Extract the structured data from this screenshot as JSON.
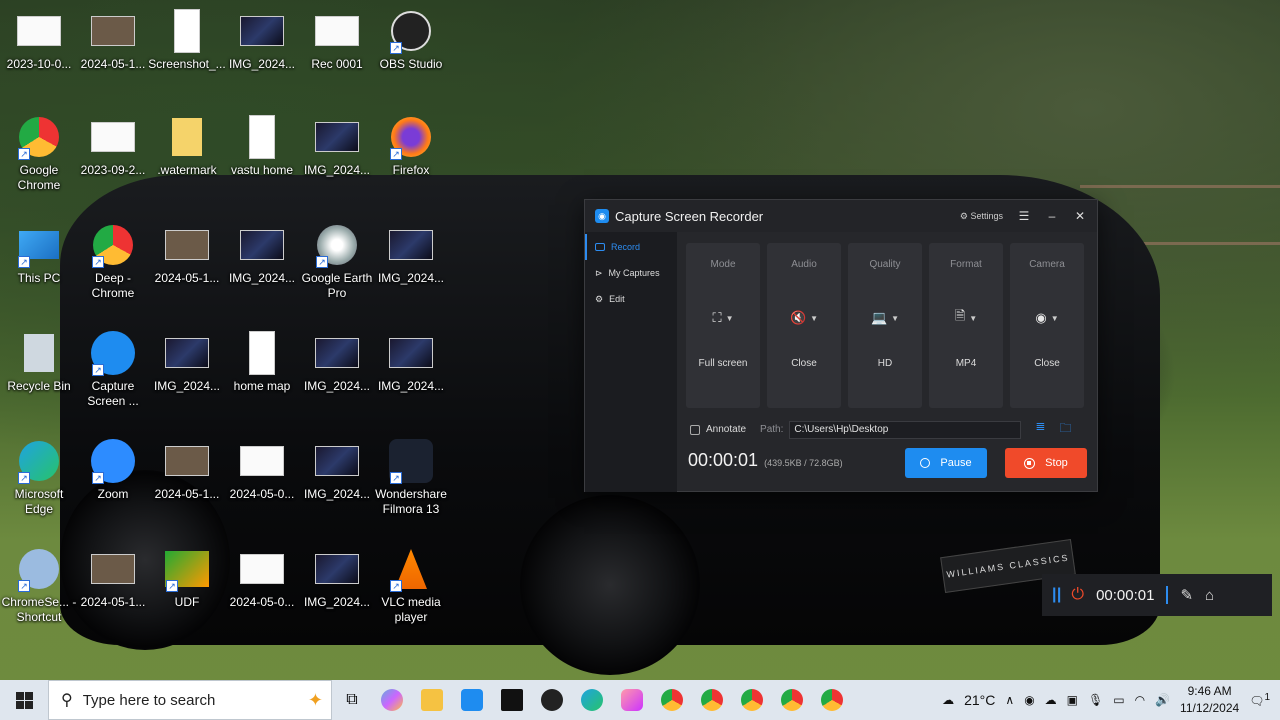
{
  "desktop": {
    "icons": [
      {
        "label": "2023-10-0...",
        "kind": "white"
      },
      {
        "label": "2024-05-1...",
        "kind": "photo"
      },
      {
        "label": "Screenshot_...",
        "kind": "paper"
      },
      {
        "label": "IMG_2024...",
        "kind": "dark"
      },
      {
        "label": "Rec 0001",
        "kind": "white"
      },
      {
        "label": "OBS Studio",
        "kind": "obs"
      },
      {
        "label": "Google Chrome",
        "kind": "chrome"
      },
      {
        "label": "2023-09-2...",
        "kind": "white"
      },
      {
        "label": ".watermark",
        "kind": "folder"
      },
      {
        "label": "vastu home",
        "kind": "paper"
      },
      {
        "label": "IMG_2024...",
        "kind": "dark"
      },
      {
        "label": "Firefox",
        "kind": "firefox"
      },
      {
        "label": "This PC",
        "kind": "pc"
      },
      {
        "label": "Deep - Chrome",
        "kind": "chrome"
      },
      {
        "label": "2024-05-1...",
        "kind": "photo"
      },
      {
        "label": "IMG_2024...",
        "kind": "dark"
      },
      {
        "label": "Google Earth Pro",
        "kind": "earth"
      },
      {
        "label": "IMG_2024...",
        "kind": "dark"
      },
      {
        "label": "Recycle Bin",
        "kind": "bin"
      },
      {
        "label": "Capture Screen ...",
        "kind": "rec"
      },
      {
        "label": "IMG_2024...",
        "kind": "dark"
      },
      {
        "label": "home map",
        "kind": "paper"
      },
      {
        "label": "IMG_2024...",
        "kind": "dark"
      },
      {
        "label": "IMG_2024...",
        "kind": "dark"
      },
      {
        "label": "Microsoft Edge",
        "kind": "edge"
      },
      {
        "label": "Zoom",
        "kind": "zoom"
      },
      {
        "label": "2024-05-1...",
        "kind": "photo"
      },
      {
        "label": "2024-05-0...",
        "kind": "white"
      },
      {
        "label": "IMG_2024...",
        "kind": "dark"
      },
      {
        "label": "Wondershare Filmora 13",
        "kind": "filmora"
      },
      {
        "label": "ChromeSe... - Shortcut",
        "kind": "cd"
      },
      {
        "label": "2024-05-1...",
        "kind": "photo"
      },
      {
        "label": "UDF",
        "kind": "udf"
      },
      {
        "label": "2024-05-0...",
        "kind": "white"
      },
      {
        "label": "IMG_2024...",
        "kind": "dark"
      },
      {
        "label": "VLC media player",
        "kind": "vlc"
      }
    ],
    "plate_text": "WILLIAMS CLASSICS"
  },
  "recorder": {
    "title": "Capture Screen Recorder",
    "settings_label": "Settings",
    "sidebar": [
      {
        "label": "Record"
      },
      {
        "label": "My Captures"
      },
      {
        "label": "Edit"
      }
    ],
    "cards": [
      {
        "title": "Mode",
        "value": "Full screen",
        "icon": "fullscreen-icon"
      },
      {
        "title": "Audio",
        "value": "Close",
        "icon": "audio-icon"
      },
      {
        "title": "Quality",
        "value": "HD",
        "icon": "laptop-icon"
      },
      {
        "title": "Format",
        "value": "MP4",
        "icon": "file-icon"
      },
      {
        "title": "Camera",
        "value": "Close",
        "icon": "camera-icon"
      }
    ],
    "annotate_label": "Annotate",
    "path_label": "Path:",
    "path_value": "C:\\Users\\Hp\\Desktop",
    "timer": "00:00:01",
    "size": "(439.5KB / 72.8GB)",
    "pause_label": "Pause",
    "stop_label": "Stop",
    "accent": "#1e8cf0",
    "stop_color": "#f04a2a"
  },
  "mini_toolbar": {
    "timer": "00:00:01"
  },
  "taskbar": {
    "search_placeholder": "Type here to search",
    "weather": "21°C",
    "notification_count": "1",
    "time": "9:46 AM",
    "date": "11/12/2024"
  }
}
